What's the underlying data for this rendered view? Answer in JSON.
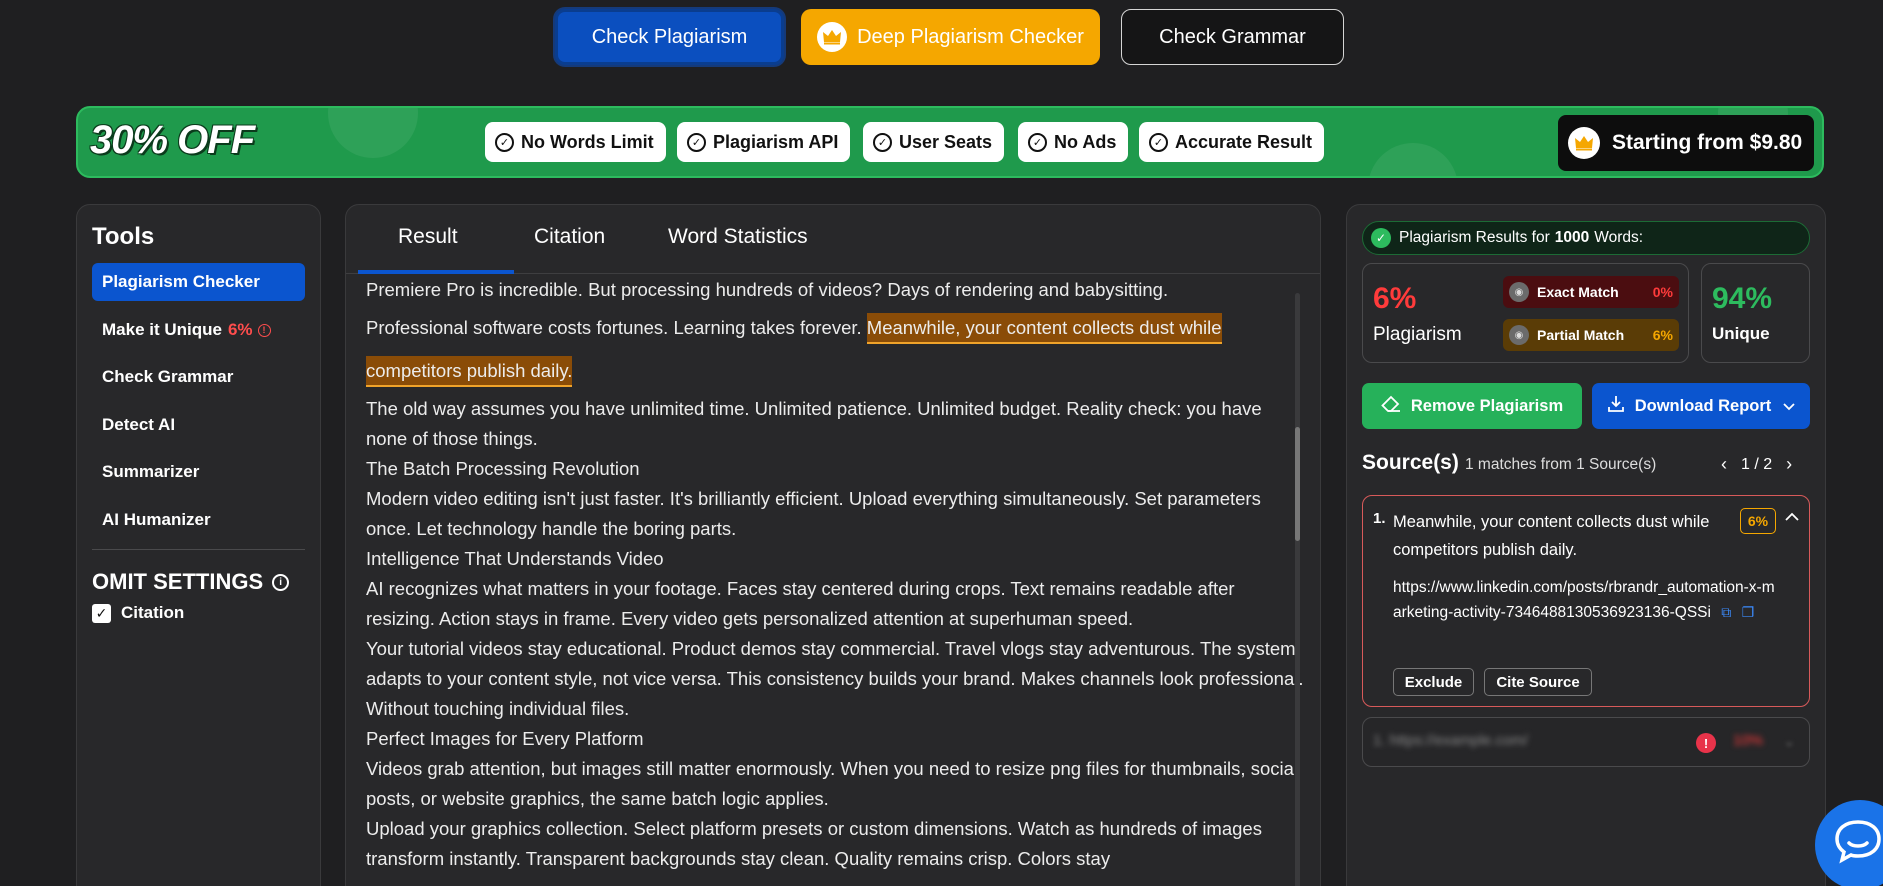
{
  "top_buttons": {
    "check": "Check Plagiarism",
    "deep": "Deep Plagiarism Checker",
    "grammar": "Check Grammar"
  },
  "promo": {
    "title": "30% OFF",
    "features": [
      "No Words Limit",
      "Plagiarism API",
      "User Seats",
      "No Ads",
      "Accurate Result"
    ],
    "price": "Starting from $9.80"
  },
  "tools": {
    "title": "Tools",
    "items": [
      {
        "label": "Plagiarism Checker"
      },
      {
        "label": "Make it Unique",
        "badge": "6%"
      },
      {
        "label": "Check Grammar"
      },
      {
        "label": "Detect AI"
      },
      {
        "label": "Summarizer"
      },
      {
        "label": "AI Humanizer"
      }
    ],
    "omit_title": "OMIT SETTINGS",
    "citation_label": "Citation"
  },
  "main": {
    "tabs": [
      "Result",
      "Citation",
      "Word Statistics"
    ],
    "lines": {
      "l0": "Premiere Pro is incredible. But processing hundreds of videos? Days of rendering and babysitting.",
      "l1a": "Professional software costs fortunes. Learning takes forever. ",
      "l1b": "Meanwhile, your content collects dust while",
      "l2": "competitors publish daily.",
      "l3": "The old way assumes you have unlimited time. Unlimited patience. Unlimited budget. Reality check: you have none of those things.",
      "l4": "The Batch Processing Revolution",
      "l5": "Modern video editing isn't just faster. It's brilliantly efficient. Upload everything simultaneously. Set parameters once. Let technology handle the boring parts.",
      "l6": "Intelligence That Understands Video",
      "l7": "AI recognizes what matters in your footage. Faces stay centered during crops. Text remains readable after resizing. Action stays in frame. Every video gets personalized attention at superhuman speed.",
      "l8": "Your tutorial videos stay educational. Product demos stay commercial. Travel vlogs stay adventurous. The system adapts to your content style, not vice versa. This consistency builds your brand. Makes channels look professional. Without touching individual files.",
      "l9": "Perfect Images for Every Platform",
      "l10": "Videos grab attention, but images still matter enormously. When you need to resize png files for thumbnails, social posts, or website graphics, the same batch logic applies.",
      "l11": "Upload your graphics collection. Select platform presets or custom dimensions. Watch as hundreds of images transform instantly. Transparent backgrounds stay clean. Quality remains crisp. Colors stay"
    }
  },
  "results": {
    "header_prefix": "Plagiarism Results for",
    "header_words": "1000",
    "header_suffix": "Words:",
    "plagiarism_pct": "6%",
    "plagiarism_label": "Plagiarism",
    "exact_label": "Exact Match",
    "exact_value": "0%",
    "partial_label": "Partial Match",
    "partial_value": "6%",
    "unique_pct": "94%",
    "unique_label": "Unique",
    "remove_label": "Remove Plagiarism",
    "download_label": "Download Report",
    "sources_title": "Source(s)",
    "sources_sub": "1 matches from 1 Source(s)",
    "sources_page": "1 / 2",
    "source1": {
      "num": "1.",
      "text": "Meanwhile, your content collects dust while competitors publish daily.",
      "badge": "6%",
      "url": "https://www.linkedin.com/posts/rbrandr_automation-x-marketing-activity-7346488130536923136-QSSi",
      "exclude": "Exclude",
      "cite": "Cite Source"
    },
    "source2": {
      "text": "1. https://example.com/",
      "pct": "10%"
    }
  },
  "colors": {
    "accent_blue": "#0b55cf",
    "accent_orange": "#f5a700",
    "promo_green": "#1f9a4c",
    "danger_red": "#ff3b3b",
    "unique_green": "#2dbb5e"
  }
}
